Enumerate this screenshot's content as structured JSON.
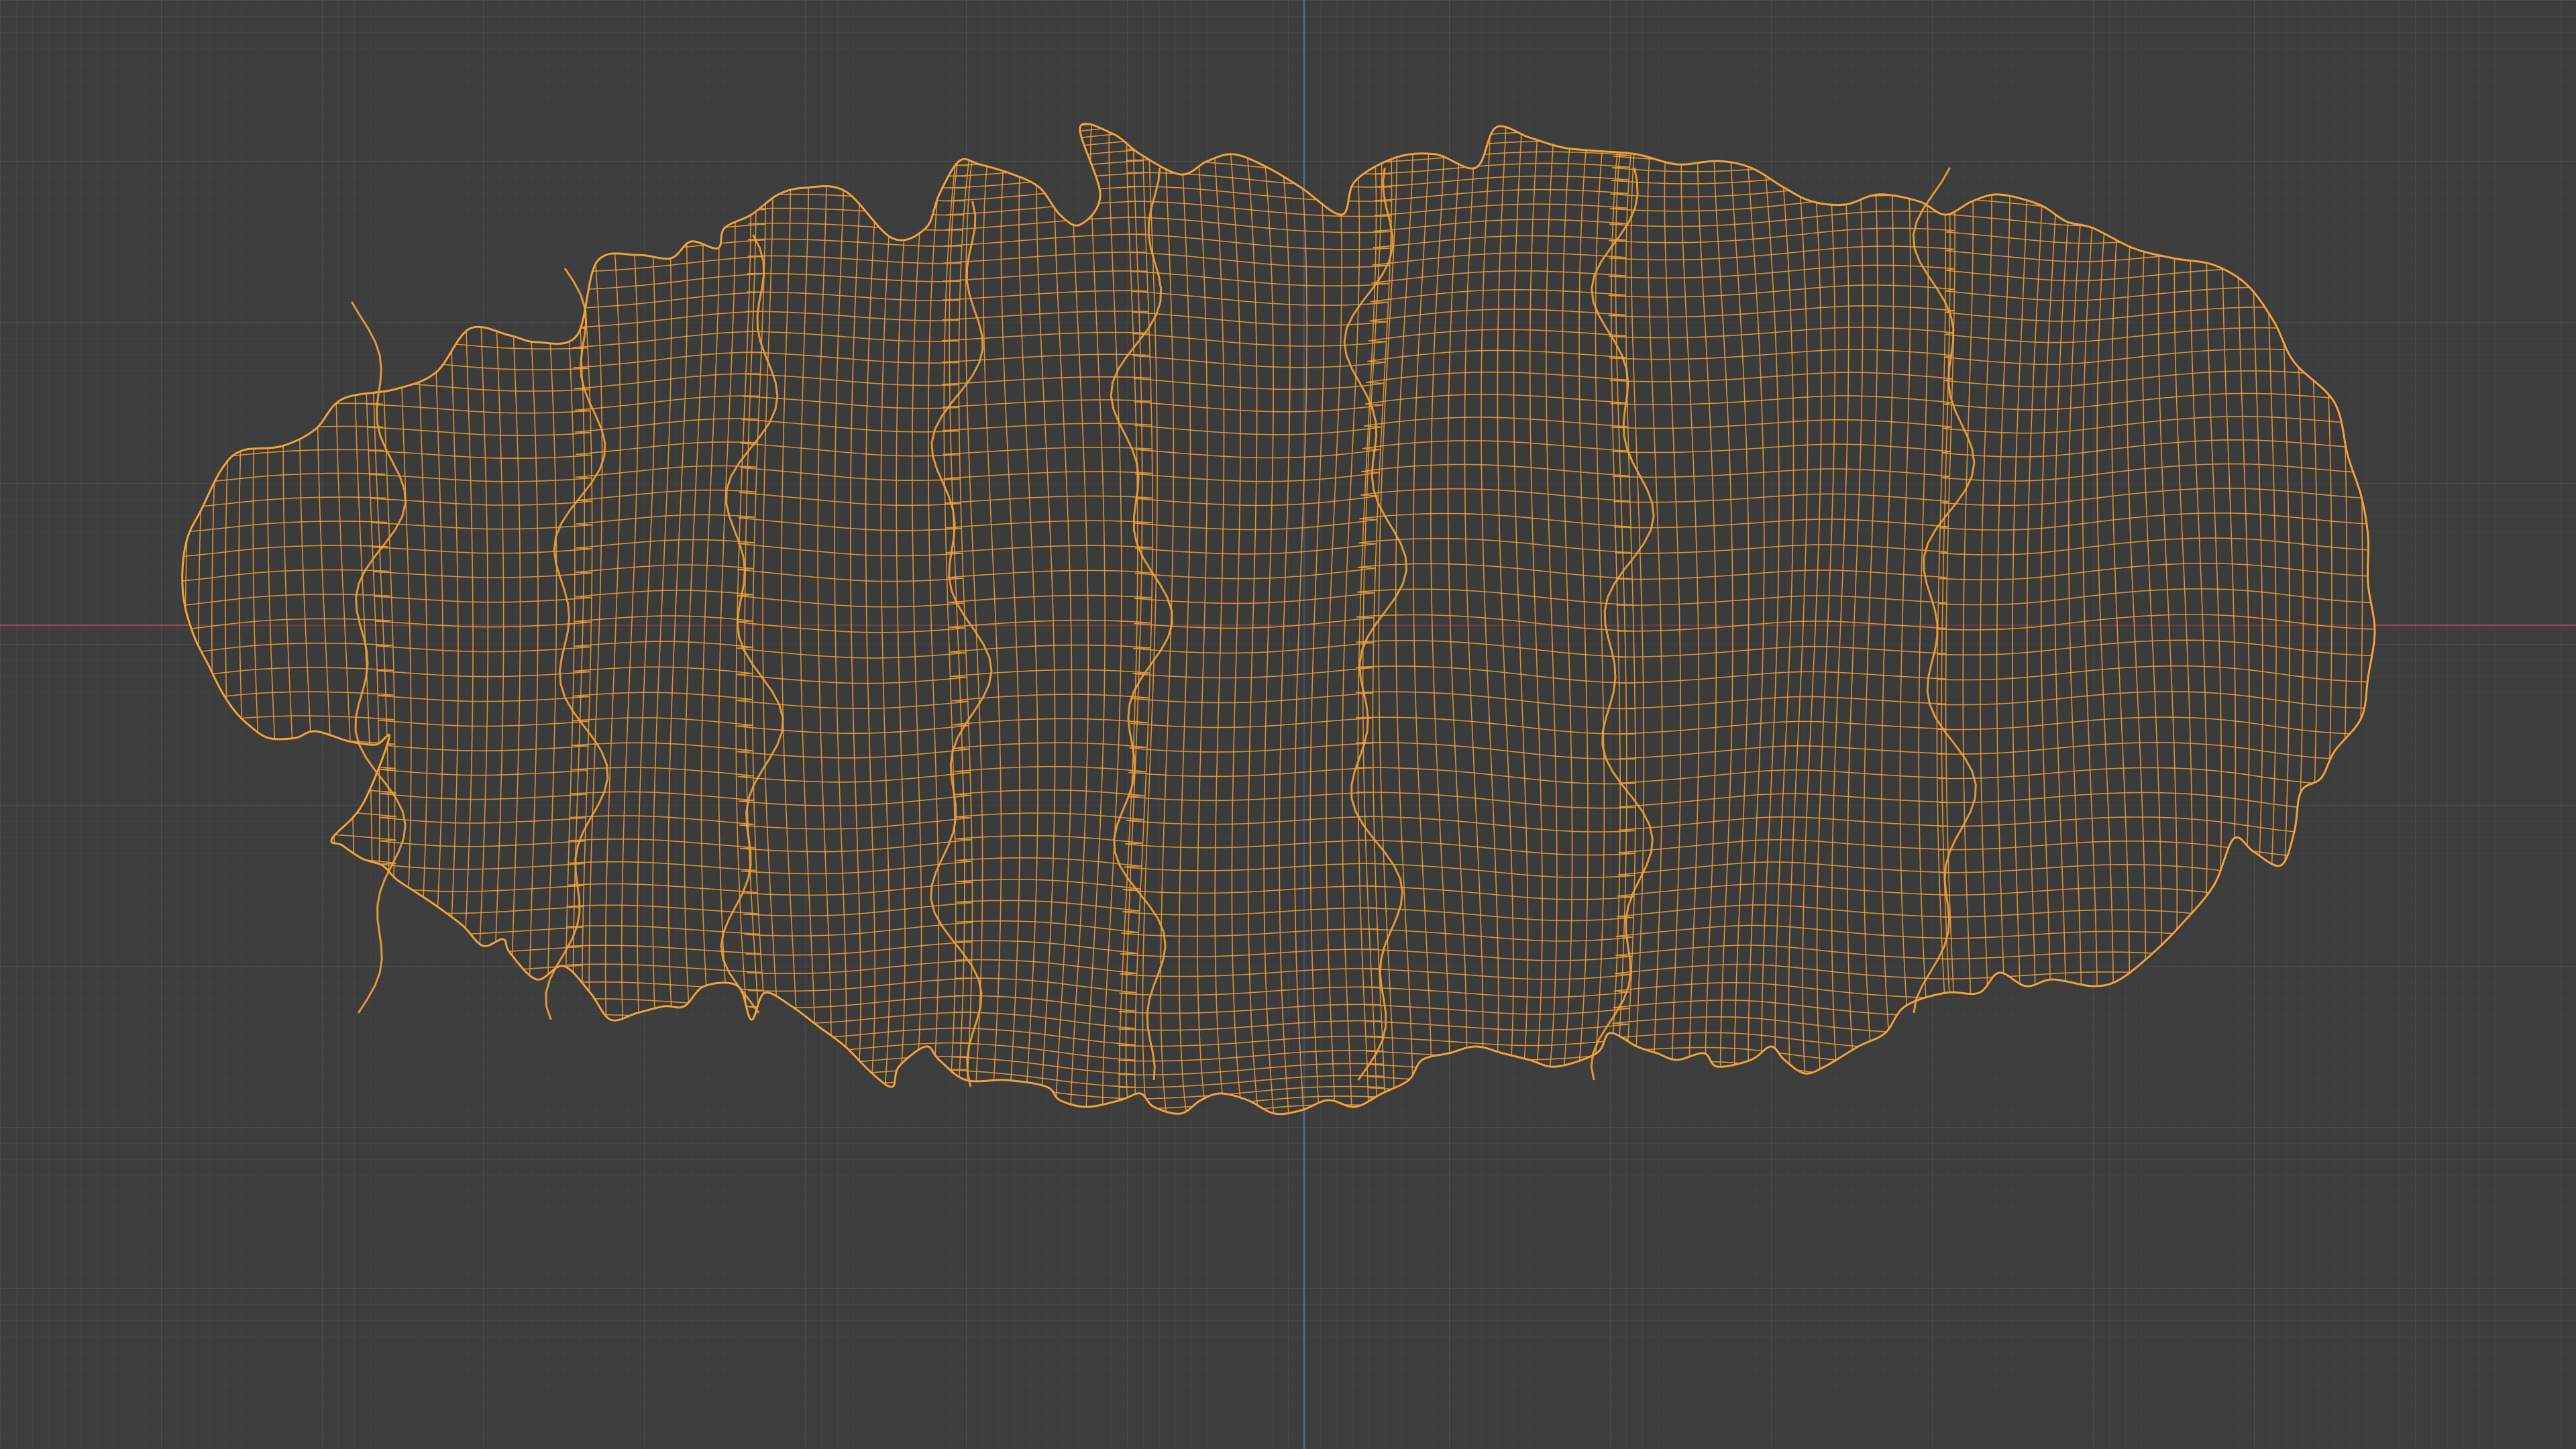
{
  "app": {
    "name": "3D viewport",
    "view_mode": "wireframe"
  },
  "colors": {
    "background": "#3d3d3d",
    "grid_minor": "#444444",
    "grid_major": "#4b4b4b",
    "axis_x": "#9a4a4a",
    "axis_y": "#4a6f99",
    "wire": "#f0a13a",
    "mesh_fill": "#3a3a3a"
  },
  "scene": {
    "selected_object": {
      "name": "",
      "display": "wireframe",
      "selected": true
    }
  }
}
